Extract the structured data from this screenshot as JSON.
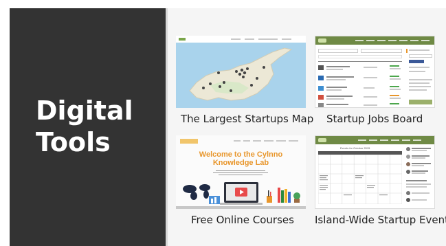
{
  "heading": {
    "line1": "Digital",
    "line2": "Tools"
  },
  "cards": [
    {
      "caption": "The Largest Startups Map"
    },
    {
      "caption": "Startup Jobs Board"
    },
    {
      "caption": "Free Online Courses"
    },
    {
      "caption": "Island-Wide Startup Events"
    }
  ],
  "thumb_courses": {
    "title1": "Welcome to the Cylnno",
    "title2": "Knowledge Lab"
  },
  "thumb_events": {
    "calendar_title": "Events for October 2015"
  },
  "colors": {
    "panel_dark": "#333333",
    "map_water": "#a9d3ec",
    "map_land": "#eae6d5",
    "navbar_green": "#6f8a45",
    "accent_orange": "#e8962b"
  }
}
